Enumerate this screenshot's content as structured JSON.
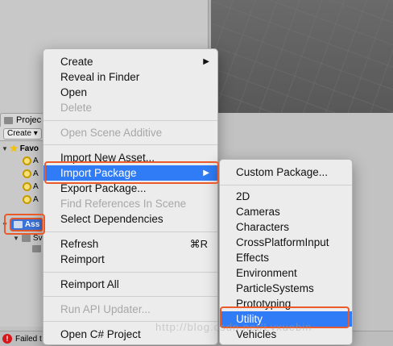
{
  "project_panel": {
    "tab_label": "Projec",
    "create_label": "Create ▾",
    "favorites_label": "Favo",
    "search_items": [
      "A",
      "A",
      "A",
      "A"
    ],
    "assets_label": "Ass",
    "sub_items": [
      "Sv",
      ""
    ]
  },
  "context_menu": {
    "items": [
      {
        "label": "Create",
        "state": "enabled",
        "arrow": "▶"
      },
      {
        "label": "Reveal in Finder",
        "state": "enabled"
      },
      {
        "label": "Open",
        "state": "enabled"
      },
      {
        "label": "Delete",
        "state": "disabled"
      },
      {
        "label": "Open Scene Additive",
        "state": "disabled"
      },
      {
        "label": "Import New Asset...",
        "state": "enabled"
      },
      {
        "label": "Import Package",
        "state": "active",
        "arrow": "▶"
      },
      {
        "label": "Export Package...",
        "state": "enabled"
      },
      {
        "label": "Find References In Scene",
        "state": "disabled"
      },
      {
        "label": "Select Dependencies",
        "state": "enabled"
      },
      {
        "label": "Refresh",
        "state": "enabled",
        "shortcut": "⌘R"
      },
      {
        "label": "Reimport",
        "state": "enabled"
      },
      {
        "label": "Reimport All",
        "state": "enabled"
      },
      {
        "label": "Run API Updater...",
        "state": "disabled"
      },
      {
        "label": "Open C# Project",
        "state": "enabled"
      }
    ]
  },
  "submenu": {
    "items": [
      {
        "label": "Custom Package..."
      },
      {
        "label": "2D"
      },
      {
        "label": "Cameras"
      },
      {
        "label": "Characters"
      },
      {
        "label": "CrossPlatformInput"
      },
      {
        "label": "Effects"
      },
      {
        "label": "Environment"
      },
      {
        "label": "ParticleSystems"
      },
      {
        "label": "Prototyping"
      },
      {
        "label": "Utility",
        "state": "active"
      },
      {
        "label": "Vehicles"
      }
    ]
  },
  "status_bar": {
    "error_icon": "!",
    "message": "Failed t"
  },
  "watermark": "http://blog.csdn.net/Lvxuebin",
  "colors": {
    "highlight": "#2f7cf6",
    "annotation": "#ea5a2b",
    "error": "#d6161a"
  }
}
